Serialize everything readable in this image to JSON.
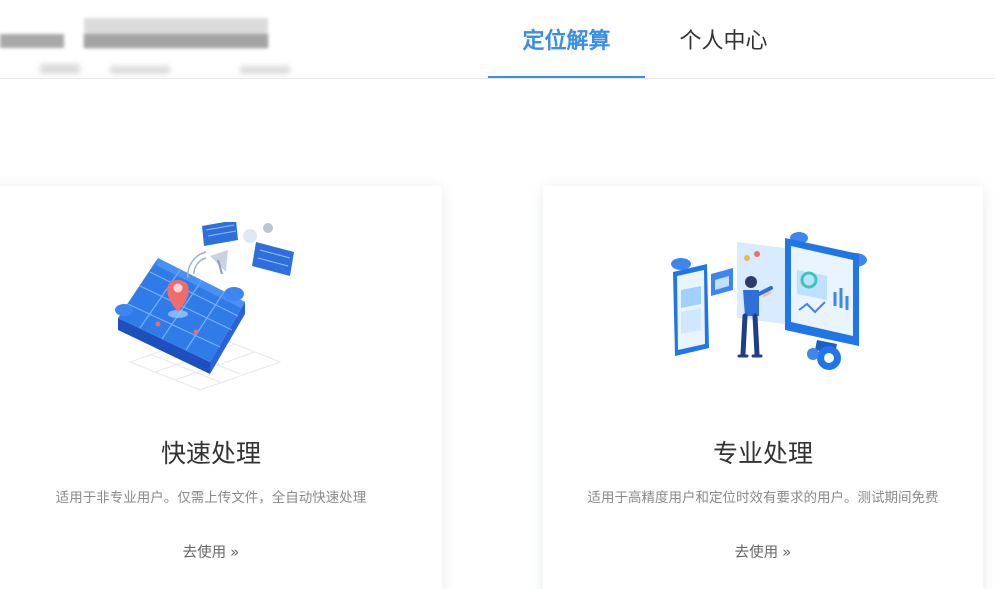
{
  "header": {
    "tabs": [
      {
        "label": "定位解算",
        "active": true
      },
      {
        "label": "个人中心",
        "active": false
      }
    ],
    "accent_color": "#3a8ee6"
  },
  "cards": [
    {
      "title": "快速处理",
      "description": "适用于非专业用户。仅需上传文件，全自动快速处理",
      "link_label": "去使用",
      "link_icon": "double-chevron-right-icon",
      "illustration": "satellite-map-illustration"
    },
    {
      "title": "专业处理",
      "description": "适用于高精度用户和定位时效有要求的用户。测试期间免费",
      "link_label": "去使用",
      "link_icon": "double-chevron-right-icon",
      "illustration": "monitor-analyst-illustration"
    }
  ]
}
